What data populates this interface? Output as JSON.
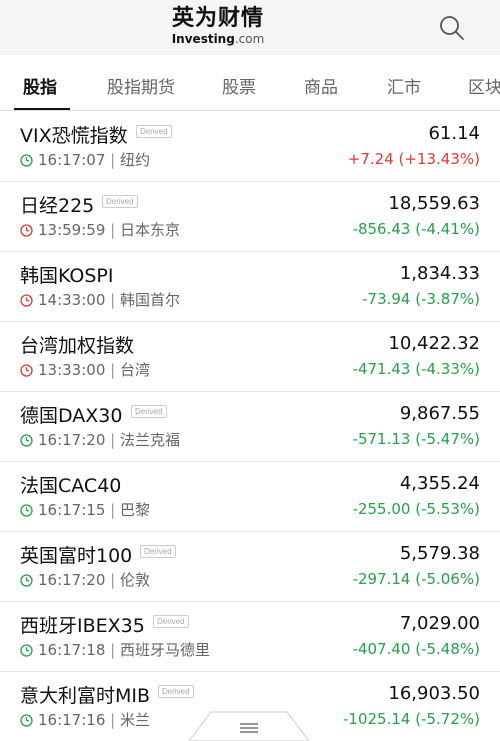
{
  "header": {
    "logo_cn": "英为财情",
    "logo_en": "Investing",
    "logo_com": ".com"
  },
  "tabs": [
    {
      "label": "股指",
      "active": true
    },
    {
      "label": "股指期货"
    },
    {
      "label": "股票"
    },
    {
      "label": "商品"
    },
    {
      "label": "汇市"
    },
    {
      "label": "区块"
    }
  ],
  "derived_badge": "Derived",
  "colors": {
    "up": "#e03a3a",
    "down": "#27a14a",
    "clock_live": "#27a14a",
    "clock_closed": "#e03a3a"
  },
  "indices": [
    {
      "name": "VIX恐慌指数",
      "derived": true,
      "price": "61.14",
      "time": "16:17:07",
      "location": "纽约",
      "change": "+7.24 (+13.43%)",
      "direction": "up",
      "clock": "live"
    },
    {
      "name": "日经225",
      "derived": true,
      "price": "18,559.63",
      "time": "13:59:59",
      "location": "日本东京",
      "change": "-856.43 (-4.41%)",
      "direction": "down",
      "clock": "closed"
    },
    {
      "name": "韩国KOSPI",
      "derived": false,
      "price": "1,834.33",
      "time": "14:33:00",
      "location": "韩国首尔",
      "change": "-73.94 (-3.87%)",
      "direction": "down",
      "clock": "closed"
    },
    {
      "name": "台湾加权指数",
      "derived": false,
      "price": "10,422.32",
      "time": "13:33:00",
      "location": "台湾",
      "change": "-471.43 (-4.33%)",
      "direction": "down",
      "clock": "closed"
    },
    {
      "name": "德国DAX30",
      "derived": true,
      "price": "9,867.55",
      "time": "16:17:20",
      "location": "法兰克福",
      "change": "-571.13 (-5.47%)",
      "direction": "down",
      "clock": "live"
    },
    {
      "name": "法国CAC40",
      "derived": false,
      "price": "4,355.24",
      "time": "16:17:15",
      "location": "巴黎",
      "change": "-255.00 (-5.53%)",
      "direction": "down",
      "clock": "live"
    },
    {
      "name": "英国富时100",
      "derived": true,
      "price": "5,579.38",
      "time": "16:17:20",
      "location": "伦敦",
      "change": "-297.14 (-5.06%)",
      "direction": "down",
      "clock": "live"
    },
    {
      "name": "西班牙IBEX35",
      "derived": true,
      "price": "7,029.00",
      "time": "16:17:18",
      "location": "西班牙马德里",
      "change": "-407.40 (-5.48%)",
      "direction": "down",
      "clock": "live"
    },
    {
      "name": "意大利富时MIB",
      "derived": true,
      "price": "16,903.50",
      "time": "16:17:16",
      "location": "米兰",
      "change": "-1025.14 (-5.72%)",
      "direction": "down",
      "clock": "live"
    }
  ]
}
